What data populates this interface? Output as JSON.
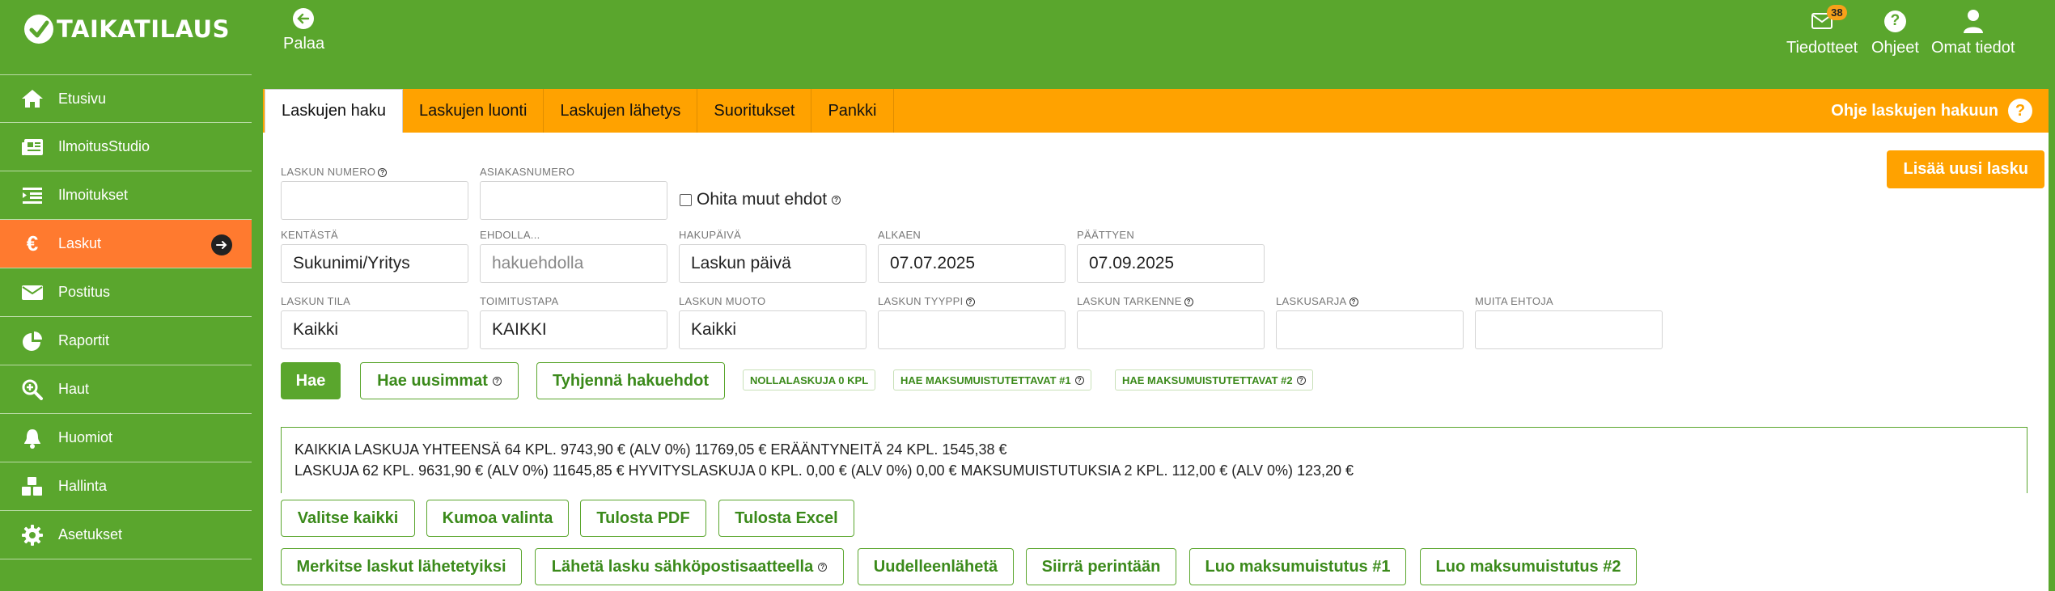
{
  "header": {
    "logo_text": "TAIKATILAUS",
    "back_label": "Palaa",
    "notifications": {
      "label": "Tiedotteet",
      "count": "38"
    },
    "help": {
      "label": "Ohjeet"
    },
    "profile": {
      "label": "Omat tiedot"
    }
  },
  "sidebar": {
    "items": [
      {
        "label": "Etusivu",
        "icon": "home-icon"
      },
      {
        "label": "IlmoitusStudio",
        "icon": "newspaper-icon"
      },
      {
        "label": "Ilmoitukset",
        "icon": "list-icon"
      },
      {
        "label": "Laskut",
        "icon": "euro-icon",
        "active": true
      },
      {
        "label": "Postitus",
        "icon": "envelope-icon"
      },
      {
        "label": "Raportit",
        "icon": "pie-chart-icon"
      },
      {
        "label": "Haut",
        "icon": "search-icon"
      },
      {
        "label": "Huomiot",
        "icon": "bell-icon"
      },
      {
        "label": "Hallinta",
        "icon": "cubes-icon"
      },
      {
        "label": "Asetukset",
        "icon": "gear-icon"
      }
    ]
  },
  "tabs": [
    "Laskujen haku",
    "Laskujen luonti",
    "Laskujen lähetys",
    "Suoritukset",
    "Pankki"
  ],
  "help_link": "Ohje laskujen hakuun",
  "add_button": "Lisää uusi lasku",
  "checkbox": {
    "label": "Ohita muut ehdot",
    "checked": false
  },
  "fields": {
    "invoice_number": {
      "label": "LASKUN NUMERO",
      "value": ""
    },
    "customer_number": {
      "label": "ASIAKASNUMERO",
      "value": ""
    },
    "field_from": {
      "label": "KENTÄSTÄ",
      "value": "Sukunimi/Yritys"
    },
    "condition": {
      "label": "EHDOLLA...",
      "placeholder": "hakuehdolla"
    },
    "search_date": {
      "label": "HAKUPÄIVÄ",
      "value": "Laskun päivä"
    },
    "start": {
      "label": "ALKAEN",
      "value": "07.07.2025"
    },
    "end": {
      "label": "PÄÄTTYEN",
      "value": "07.09.2025"
    },
    "status": {
      "label": "LASKUN TILA",
      "value": "Kaikki"
    },
    "delivery": {
      "label": "TOIMITUSTAPA",
      "value": "KAIKKI"
    },
    "form": {
      "label": "LASKUN MUOTO",
      "value": "Kaikki"
    },
    "type": {
      "label": "LASKUN TYYPPI",
      "value": ""
    },
    "specifier": {
      "label": "LASKUN TARKENNE",
      "value": ""
    },
    "series": {
      "label": "LASKUSARJA",
      "value": ""
    },
    "other": {
      "label": "MUITA EHTOJA",
      "value": ""
    }
  },
  "search_buttons": {
    "search": "Hae",
    "latest": "Hae uusimmat",
    "clear": "Tyhjennä hakuehdot"
  },
  "chips": [
    "NOLLALASKUJA 0 KPL",
    "HAE MAKSUMUISTUTETTAVAT #1",
    "HAE MAKSUMUISTUTETTAVAT #2"
  ],
  "summary": {
    "line1": "KAIKKIA LASKUJA YHTEENSÄ 64 KPL. 9743,90 € (ALV 0%)  11769,05 € ERÄÄNTYNEITÄ 24 KPL. 1545,38 €",
    "line2": "LASKUJA 62 KPL. 9631,90 € (ALV 0%)  11645,85 €   HYVITYSLASKUJA 0 KPL. 0,00 € (ALV 0%)  0,00 €   MAKSUMUISTUTUKSIA 2 KPL. 112,00 € (ALV 0%)  123,20 €"
  },
  "action_row1": [
    "Valitse kaikki",
    "Kumoa valinta",
    "Tulosta PDF",
    "Tulosta Excel"
  ],
  "action_row2": [
    "Merkitse laskut lähetetyiksi",
    "Lähetä lasku sähköpostisaatteella",
    "Uudelleenlähetä",
    "Siirrä perintään",
    "Luo maksumuistutus #1",
    "Luo maksumuistutus #2"
  ],
  "colors": {
    "green": "#5aa62d",
    "orange": "#ffa200",
    "active": "#ff7a2f"
  }
}
